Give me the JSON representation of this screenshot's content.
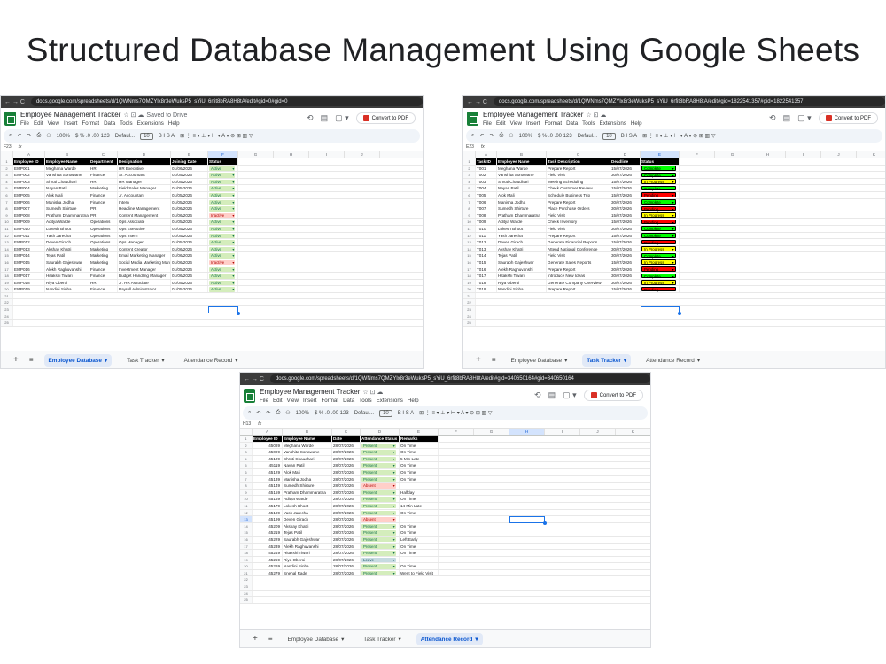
{
  "title": "Structured Database Management Using Google Sheets",
  "common": {
    "doc_title": "Employee Management Tracker",
    "saved": "Saved to Drive",
    "menus": [
      "File",
      "Edit",
      "View",
      "Insert",
      "Format",
      "Data",
      "Tools",
      "Extensions",
      "Help"
    ],
    "pdf_button": "Convert to PDF",
    "zoom": "100%",
    "font": "Defaul...",
    "font_size": "10",
    "fx": "fx",
    "nav_glyphs": "← → C",
    "title_icons": "☆ ⊡ ☁",
    "header_icons": [
      "⟲",
      "▤",
      "▢ ▾"
    ],
    "toolbar_icons": [
      "⌕",
      "↶",
      "↷",
      "⎙",
      "⚇"
    ],
    "toolbar_format": "$  %  .0  .00  123",
    "toolbar_text": "B  I  S  A",
    "toolbar_more": "⊞ ⋮ ≡ ▾ ⊥ ▾ ⊢ ▾ A ▾ ⊝ ⊞ ▥ ▽",
    "tab_icons": [
      "+",
      "≡"
    ],
    "tab_arrow": "▾"
  },
  "windows": [
    {
      "id": "employee",
      "url": "docs.google.com/spreadsheets/d/1QWNms7QMZYlx8r3eWuksP5_sYiU_6rfit8bRA8H8tA/edit#gid=0#gid=0",
      "cell_ref": "F23",
      "columns": [
        "A",
        "B",
        "C",
        "D",
        "E",
        "F",
        "G",
        "H",
        "I",
        "J"
      ],
      "selected_col": "F",
      "headers": [
        "Employee ID",
        "Employee Name",
        "Department",
        "Designation",
        "Joining Date",
        "Status"
      ],
      "rows": [
        [
          "EMP001",
          "Meghana Warde",
          "HR",
          "HR Executive",
          "01/06/2026",
          "Active"
        ],
        [
          "EMP002",
          "Vanshita Sonawane",
          "Finance",
          "Sr. Accountant",
          "01/05/2026",
          "Active"
        ],
        [
          "EMP003",
          "Shruti Chaudhari",
          "HR",
          "HR Manager",
          "01/05/2026",
          "Active"
        ],
        [
          "EMP004",
          "Nayan Patil",
          "Marketing",
          "Field Sales Manager",
          "01/05/2026",
          "Active"
        ],
        [
          "EMP005",
          "Alok Mali",
          "Finance",
          "Jr. Accountant",
          "01/05/2026",
          "Active"
        ],
        [
          "EMP006",
          "Manisha Jodha",
          "Finance",
          "Intern",
          "01/05/2026",
          "Active"
        ],
        [
          "EMP007",
          "Sumedh Shirture",
          "PR",
          "Headline Management",
          "01/06/2026",
          "Active"
        ],
        [
          "EMP008",
          "Pratham Dhammaratna",
          "PR",
          "Content Management",
          "01/06/2026",
          "Inactive"
        ],
        [
          "EMP009",
          "Aditya Warde",
          "Operations",
          "Ops Associate",
          "01/05/2026",
          "Active"
        ],
        [
          "EMP010",
          "Lokesh Bhoot",
          "Operations",
          "Ops Executive",
          "01/05/2026",
          "Active"
        ],
        [
          "EMP011",
          "Yash Jarecha",
          "Operations",
          "Ops Intern",
          "01/05/2026",
          "Active"
        ],
        [
          "EMP012",
          "Deven Girach",
          "Operations",
          "Ops Manager",
          "01/05/2026",
          "Active"
        ],
        [
          "EMP013",
          "Akshay Khatri",
          "Marketing",
          "Content Creator",
          "01/06/2026",
          "Active"
        ],
        [
          "EMP014",
          "Tejas Patil",
          "Marketing",
          "Email Marketing Manager",
          "01/06/2026",
          "Active"
        ],
        [
          "EMP015",
          "Saurabh Gajeshwar",
          "Marketing",
          "Social Media Marketing Manager",
          "01/06/2026",
          "Inactive"
        ],
        [
          "EMP016",
          "Alekh Raghuvanshi",
          "Finance",
          "Investment Manager",
          "01/05/2026",
          "Active"
        ],
        [
          "EMP017",
          "Hitakshi Tiwari",
          "Finance",
          "Budget Handling Manager",
          "01/06/2026",
          "Active"
        ],
        [
          "EMP018",
          "Riya Oberoi",
          "HR",
          "Jr. HR Associate",
          "01/05/2026",
          "Active"
        ],
        [
          "EMP019",
          "Nandini Sinha",
          "Finance",
          "Payroll Administrator",
          "01/05/2026",
          "Active"
        ]
      ],
      "extra_row_numbers": [
        "21",
        "22",
        "23",
        "24",
        "25"
      ],
      "tabs": [
        "Employee Database",
        "Task Tracker",
        "Attendance Record"
      ],
      "active_tab": 0
    },
    {
      "id": "task",
      "url": "docs.google.com/spreadsheets/d/1QWNms7QMZYlx8r3eWuksP5_sYiU_6rfit8bRA8H8tA/edit#gid=1822541357#gid=1822541357",
      "cell_ref": "E23",
      "columns": [
        "A",
        "B",
        "C",
        "D",
        "E",
        "F",
        "G",
        "H",
        "I",
        "J",
        "K"
      ],
      "selected_col": "E",
      "headers": [
        "Task ID",
        "Employee Name",
        "Task Description",
        "Deadline",
        "Status"
      ],
      "rows": [
        [
          "T001",
          "Meghana Warde",
          "Prepare Report",
          "15/07/2026",
          "Complete"
        ],
        [
          "T002",
          "Vanshita Sonawane",
          "Field Visit",
          "30/07/2026",
          "Complete"
        ],
        [
          "T003",
          "Shruti Chaudhari",
          "Meeting Scheduling",
          "15/07/2026",
          "In Progress"
        ],
        [
          "T004",
          "Nayan Patil",
          "Check Customer Review",
          "15/07/2026",
          "Complete"
        ],
        [
          "T005",
          "Alok Mali",
          "Schedule Business Trip",
          "15/07/2026",
          "Pending"
        ],
        [
          "T006",
          "Manisha Jodha",
          "Prepare Report",
          "30/07/2026",
          "Complete"
        ],
        [
          "T007",
          "Sumedh Shirture",
          "Place Purchase Orders",
          "30/07/2026",
          "Pending"
        ],
        [
          "T008",
          "Pratham Dhammaratna",
          "Field Visit",
          "15/07/2026",
          "In Progress"
        ],
        [
          "T009",
          "Aditya Warde",
          "Check Inventory",
          "15/07/2026",
          "Pending"
        ],
        [
          "T010",
          "Lokesh Bhoot",
          "Field Visit",
          "30/07/2026",
          "Complete"
        ],
        [
          "T011",
          "Yash Jarecha",
          "Prepare Report",
          "15/07/2026",
          "Complete"
        ],
        [
          "T012",
          "Deven Girach",
          "Generate Financial Reports",
          "15/07/2026",
          "Pending"
        ],
        [
          "T013",
          "Akshay Khatri",
          "Attend National Conference",
          "30/07/2026",
          "In Progress"
        ],
        [
          "T014",
          "Tejas Patil",
          "Field Visit",
          "30/07/2026",
          "Complete"
        ],
        [
          "T015",
          "Saurabh Gajeshwar",
          "Generate Sales Reports",
          "15/07/2026",
          "In Progress"
        ],
        [
          "T016",
          "Alekh Raghuvanshi",
          "Prepare Report",
          "30/07/2026",
          "Pending"
        ],
        [
          "T017",
          "Hitakshi Tiwari",
          "Introduce New Ideas",
          "30/07/2026",
          "Complete"
        ],
        [
          "T018",
          "Riya Oberoi",
          "Generate Company Overview",
          "30/07/2026",
          "In Progress"
        ],
        [
          "T019",
          "Nandini Sinha",
          "Prepare Report",
          "15/07/2026",
          "Pending"
        ]
      ],
      "extra_row_numbers": [
        "21",
        "22",
        "23",
        "24",
        "25"
      ],
      "tabs": [
        "Employee Database",
        "Task Tracker",
        "Attendance Record"
      ],
      "active_tab": 1
    },
    {
      "id": "attendance",
      "url": "docs.google.com/spreadsheets/d/1QWNms7QMZYlx8r3eWuksP5_sYiU_6rfit8bRA8H8tA/edit#gid=340650164#gid=340650164",
      "cell_ref": "H13",
      "columns": [
        "A",
        "B",
        "C",
        "D",
        "E",
        "F",
        "G",
        "H",
        "I",
        "J",
        "K"
      ],
      "selected_col": "H",
      "headers": [
        "Employee ID",
        "Employee Name",
        "Date",
        "Attendance Status",
        "Remarks"
      ],
      "rows": [
        [
          "45089",
          "Meghana Warde",
          "28/07/2026",
          "Present",
          "On Time"
        ],
        [
          "45099",
          "Vanshita Sonawane",
          "28/07/2026",
          "Present",
          "On Time"
        ],
        [
          "45109",
          "Shruti Chaudhari",
          "28/07/2026",
          "Present",
          "5 Min Late"
        ],
        [
          "45119",
          "Nayan Patil",
          "28/07/2026",
          "Present",
          "On Time"
        ],
        [
          "45129",
          "Alok Mali",
          "28/07/2026",
          "Present",
          "On Time"
        ],
        [
          "45139",
          "Manisha Jodha",
          "28/07/2026",
          "Present",
          "On Time"
        ],
        [
          "45149",
          "Sumedh Shirture",
          "28/07/2026",
          "Absent",
          ""
        ],
        [
          "45159",
          "Pratham Dhammaratna",
          "28/07/2026",
          "Present",
          "Halfday"
        ],
        [
          "45169",
          "Aditya Warde",
          "28/07/2026",
          "Present",
          "On Time"
        ],
        [
          "45179",
          "Lokesh Bhoot",
          "28/07/2026",
          "Present",
          "14 Min Late"
        ],
        [
          "45189",
          "Yash Jarecha",
          "28/07/2026",
          "Present",
          "On Time"
        ],
        [
          "45199",
          "Deven Girach",
          "28/07/2026",
          "Absent",
          ""
        ],
        [
          "45209",
          "Akshay Khatri",
          "28/07/2026",
          "Present",
          "On Time"
        ],
        [
          "45219",
          "Tejas Patil",
          "28/07/2026",
          "Present",
          "On Time"
        ],
        [
          "45229",
          "Saurabh Gajeshwar",
          "28/07/2026",
          "Present",
          "Left Early"
        ],
        [
          "45239",
          "Alekh Raghuvanshi",
          "28/07/2026",
          "Present",
          "On Time"
        ],
        [
          "45249",
          "Hitakshi Tiwari",
          "28/07/2026",
          "Present",
          "On Time"
        ],
        [
          "45259",
          "Riya Oberoi",
          "28/07/2026",
          "Leave",
          ""
        ],
        [
          "45269",
          "Nandini Sinha",
          "28/07/2026",
          "Present",
          "On Time"
        ],
        [
          "45279",
          "Snehal Rade",
          "28/07/2026",
          "Present",
          "Went to Field Visit"
        ]
      ],
      "extra_row_numbers": [
        "22",
        "23",
        "24",
        "25"
      ],
      "selected_row": "13",
      "tabs": [
        "Employee Database",
        "Task Tracker",
        "Attendance Record"
      ],
      "active_tab": 2
    }
  ]
}
